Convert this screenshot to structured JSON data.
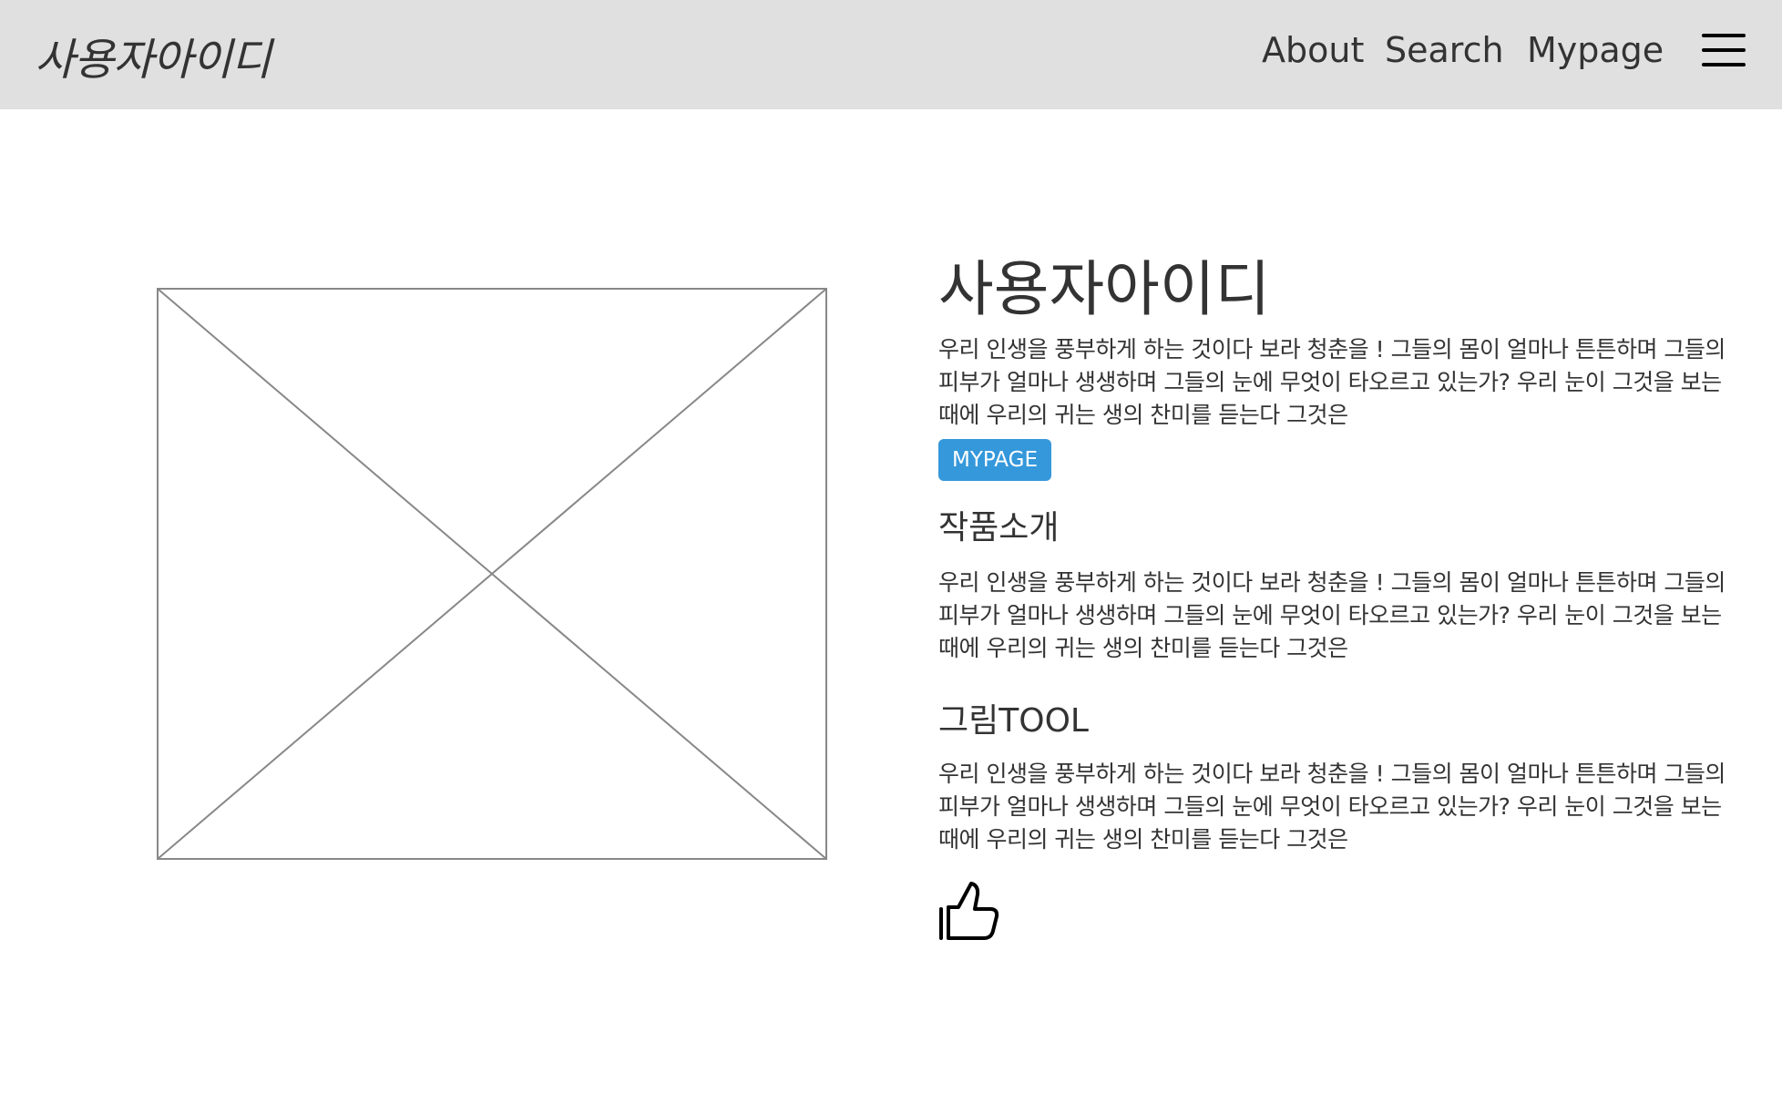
{
  "navbar": {
    "brand": "사용자아이디",
    "links": [
      "About",
      "Search",
      "Mypage"
    ],
    "menu_icon": "hamburger-icon"
  },
  "profile": {
    "image_icon": "image-placeholder-icon",
    "title": "사용자아이디",
    "intro": "우리 인생을 풍부하게 하는 것이다 보라 청춘을 ! 그들의 몸이 얼마나 튼튼하며 그들의 피부가 얼마나 생생하며 그들의 눈에 무엇이 타오르고 있는가? 우리 눈이 그것을 보는 때에 우리의 귀는 생의 찬미를 듣는다 그것은",
    "button_label": "MYPAGE",
    "button_color": "#3498db"
  },
  "sections": [
    {
      "title": "작품소개",
      "text": "우리 인생을 풍부하게 하는 것이다 보라 청춘을 ! 그들의 몸이 얼마나 튼튼하며 그들의 피부가 얼마나 생생하며 그들의 눈에 무엇이 타오르고 있는가? 우리 눈이 그것을 보는 때에 우리의 귀는 생의 찬미를 듣는다 그것은"
    },
    {
      "title": "그림TOOL",
      "text": "우리 인생을 풍부하게 하는 것이다 보라 청춘을 ! 그들의 몸이 얼마나 튼튼하며 그들의 피부가 얼마나 생생하며 그들의 눈에 무엇이 타오르고 있는가? 우리 눈이 그것을 보는 때에 우리의 귀는 생의 찬미를 듣는다 그것은"
    }
  ],
  "like_icon": "thumbs-up-icon"
}
